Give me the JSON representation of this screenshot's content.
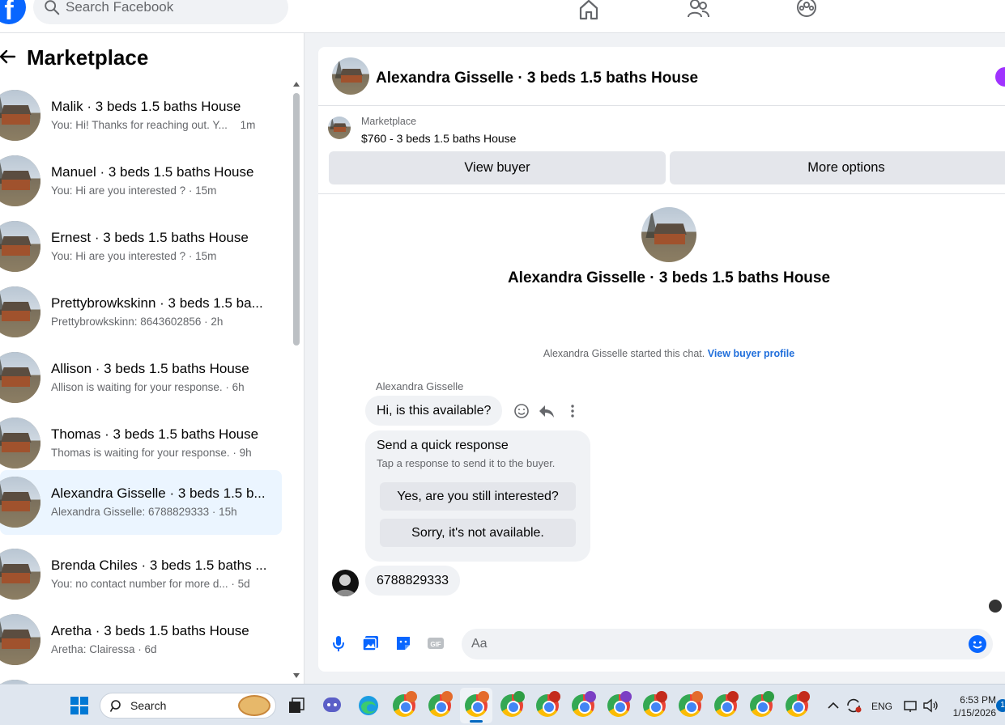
{
  "topbar": {
    "search_placeholder": "Search Facebook",
    "logo_letter": "f"
  },
  "sidebar": {
    "title": "Marketplace",
    "conversations": [
      {
        "name": "Malik · 3 beds 1.5 baths House",
        "preview": "You: Hi! Thanks for reaching out. Y...",
        "time": "1m"
      },
      {
        "name": "Manuel · 3 beds 1.5 baths House",
        "preview": "You: Hi are you interested ? · 15m",
        "time": ""
      },
      {
        "name": "Ernest · 3 beds 1.5 baths House",
        "preview": "You: Hi are you interested ? · 15m",
        "time": ""
      },
      {
        "name": "Prettybrowkskinn · 3 beds 1.5 ba...",
        "preview": "Prettybrowkskinn: 8643602856 · 2h",
        "time": ""
      },
      {
        "name": "Allison · 3 beds 1.5 baths House",
        "preview": "Allison is waiting for your response. · 6h",
        "time": ""
      },
      {
        "name": "Thomas · 3 beds 1.5 baths House",
        "preview": "Thomas is waiting for your response. · 9h",
        "time": ""
      },
      {
        "name": "Alexandra Gisselle · 3 beds 1.5 b...",
        "preview": "Alexandra Gisselle: 6788829333 · 15h",
        "time": "",
        "active": true
      },
      {
        "name": "Brenda Chiles · 3 beds 1.5 baths ...",
        "preview": "You: no contact number for more d... · 5d",
        "time": ""
      },
      {
        "name": "Aretha · 3 beds 1.5 baths House",
        "preview": "Aretha: Clairessa · 6d",
        "time": ""
      }
    ]
  },
  "chat": {
    "header_title": "Alexandra Gisselle · 3 beds 1.5 baths House",
    "marketplace_label": "Marketplace",
    "listing_price_title": "$760 - 3 beds 1.5 baths House",
    "view_buyer_label": "View buyer",
    "more_options_label": "More options",
    "profile_title": "Alexandra Gisselle · 3 beds 1.5 baths House",
    "started_text": "Alexandra Gisselle started this chat.",
    "view_buyer_profile_link": "View buyer profile",
    "sender_name": "Alexandra Gisselle",
    "message_1": "Hi, is this available?",
    "quick_response": {
      "title": "Send a quick response",
      "subtitle": "Tap a response to send it to the buyer.",
      "option_1": "Yes, are you still interested?",
      "option_2": "Sorry, it's not available."
    },
    "message_2": "6788829333",
    "composer_placeholder": "Aa"
  },
  "taskbar": {
    "search_placeholder": "Search",
    "language": "ENG",
    "time": "6:53 PM",
    "date": "1/15/2026",
    "notification_count": "1"
  },
  "colors": {
    "facebook_blue": "#0866ff",
    "link_blue": "#216fdb",
    "active_row": "#ebf5ff",
    "bubble_grey": "#f0f2f5",
    "button_grey": "#e4e6eb",
    "purple_dot": "#a033ff"
  }
}
